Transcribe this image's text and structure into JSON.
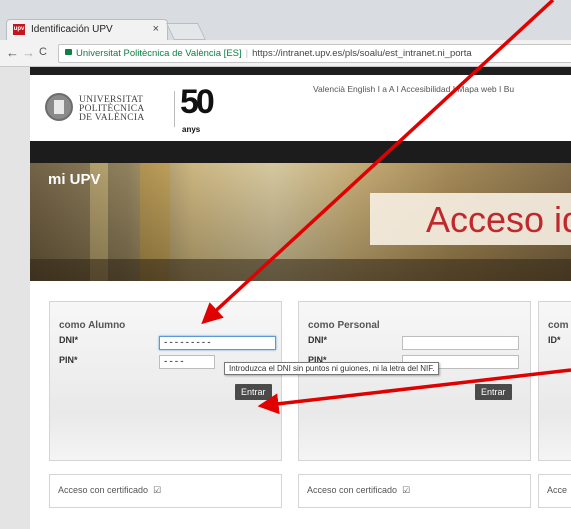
{
  "browser": {
    "tab_title": "Identificación UPV",
    "tab_close": "×",
    "favicon_text": "upv",
    "back": "←",
    "forward": "→",
    "reload": "C",
    "secure_label": "Universitat Politècnica de València [ES]",
    "url": "https://intranet.upv.es/pls/soalu/est_intranet.ni_porta"
  },
  "header": {
    "university_line1": "UNIVERSITAT",
    "university_line2": "POLITÈCNICA",
    "university_line3": "DE VALÈNCIA",
    "anniversary_number": "50",
    "anniversary_word": "anys",
    "top_links": "Valencià  English  I a   A  I Accesibilidad  I Mapa web  I Bu"
  },
  "banner": {
    "section_label": "mi UPV",
    "heading": "Acceso id"
  },
  "login": {
    "alumno": {
      "title": "como Alumno",
      "id_label": "DNI*",
      "id_value": "---------",
      "pin_label": "PIN*",
      "pin_value": "----",
      "submit": "Entrar",
      "cert": "Acceso con certificado"
    },
    "personal": {
      "title": "como Personal",
      "id_label": "DNI*",
      "id_value": "",
      "pin_label": "PIN*",
      "submit": "Entrar",
      "cert": "Acceso con certificado"
    },
    "other": {
      "title": "com",
      "id_label": "ID*",
      "cert": "Acce"
    }
  },
  "tooltip": "Introduzca el DNI sin puntos ni guiones, ni la letra del NIF.",
  "colors": {
    "accent_red": "#c0282d",
    "arrow_red": "#e00000",
    "secure_green": "#0b8043"
  }
}
